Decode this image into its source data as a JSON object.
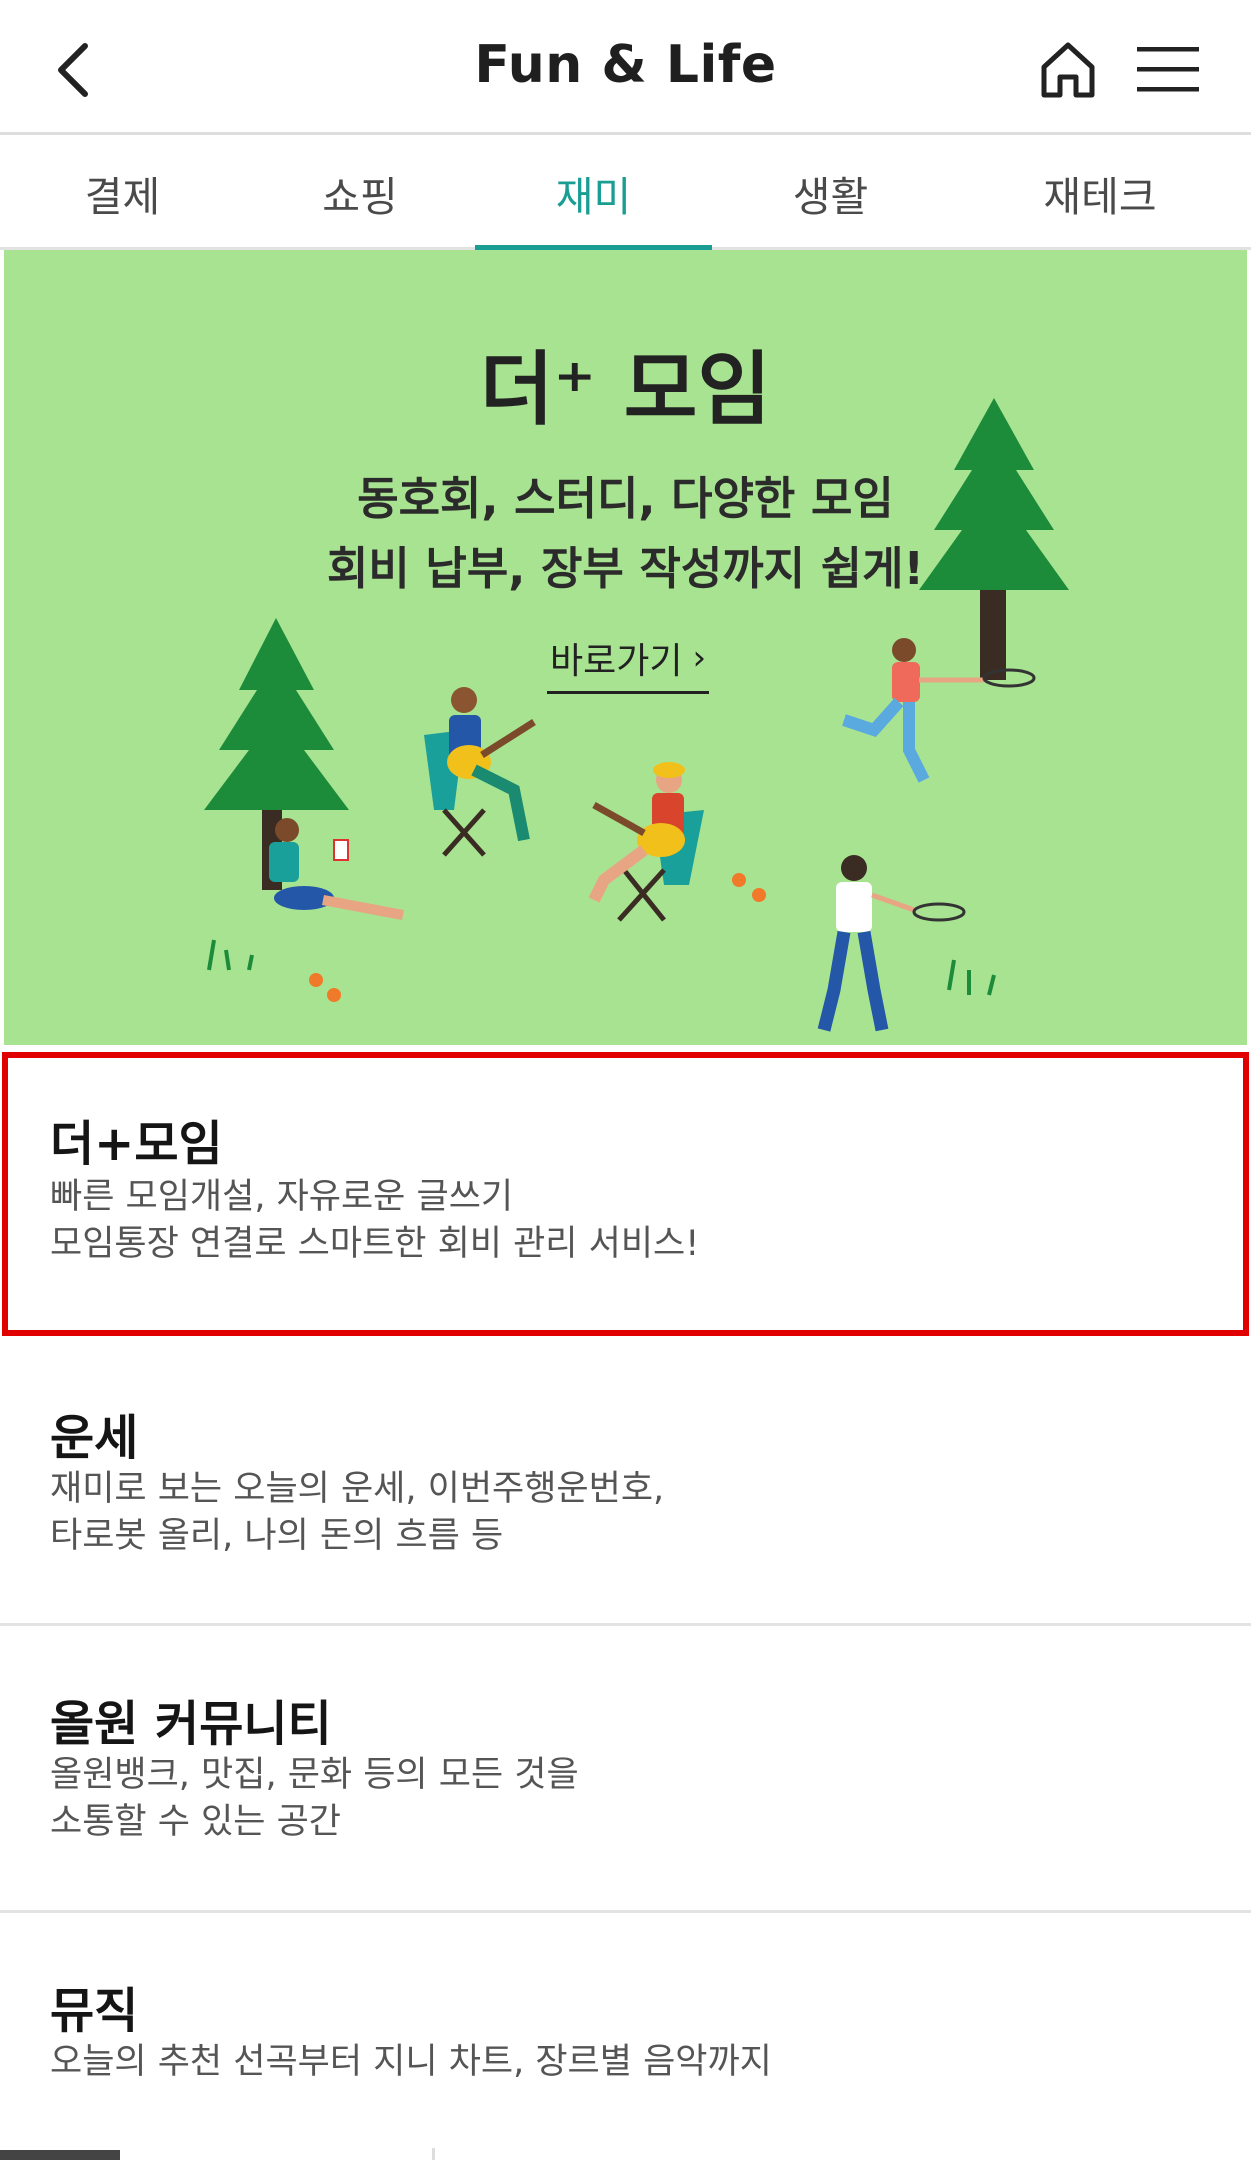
{
  "header": {
    "title": "Fun & Life",
    "back_icon": "chevron-left-icon",
    "home_icon": "home-icon",
    "menu_icon": "hamburger-menu-icon"
  },
  "tabs": [
    {
      "label": "결제",
      "active": false
    },
    {
      "label": "쇼핑",
      "active": false
    },
    {
      "label": "재미",
      "active": true
    },
    {
      "label": "생활",
      "active": false
    },
    {
      "label": "재테크",
      "active": false
    }
  ],
  "banner": {
    "title": "더⁺ 모임",
    "line1": "동호회, 스터디, 다양한 모임",
    "line2": "회비 납부, 장부 작성까지 쉽게!",
    "link_label": "바로가기",
    "background_color": "#a8e391"
  },
  "items": [
    {
      "title": "더+모임",
      "desc1": "빠른 모임개설, 자유로운 글쓰기",
      "desc2": "모임통장 연결로 스마트한 회비 관리 서비스!"
    },
    {
      "title": "운세",
      "desc1": "재미로 보는 오늘의 운세, 이번주행운번호,",
      "desc2": "타로봇 올리, 나의 돈의 흐름 등"
    },
    {
      "title": "올원 커뮤니티",
      "desc1": "올원뱅크, 맛집, 문화 등의 모든 것을",
      "desc2": "소통할 수 있는 공간"
    },
    {
      "title": "뮤직",
      "desc1": "오늘의 추천 선곡부터 지니 차트, 장르별 음악까지"
    }
  ],
  "colors": {
    "accent": "#1a9e93",
    "highlight": "#e00000"
  }
}
